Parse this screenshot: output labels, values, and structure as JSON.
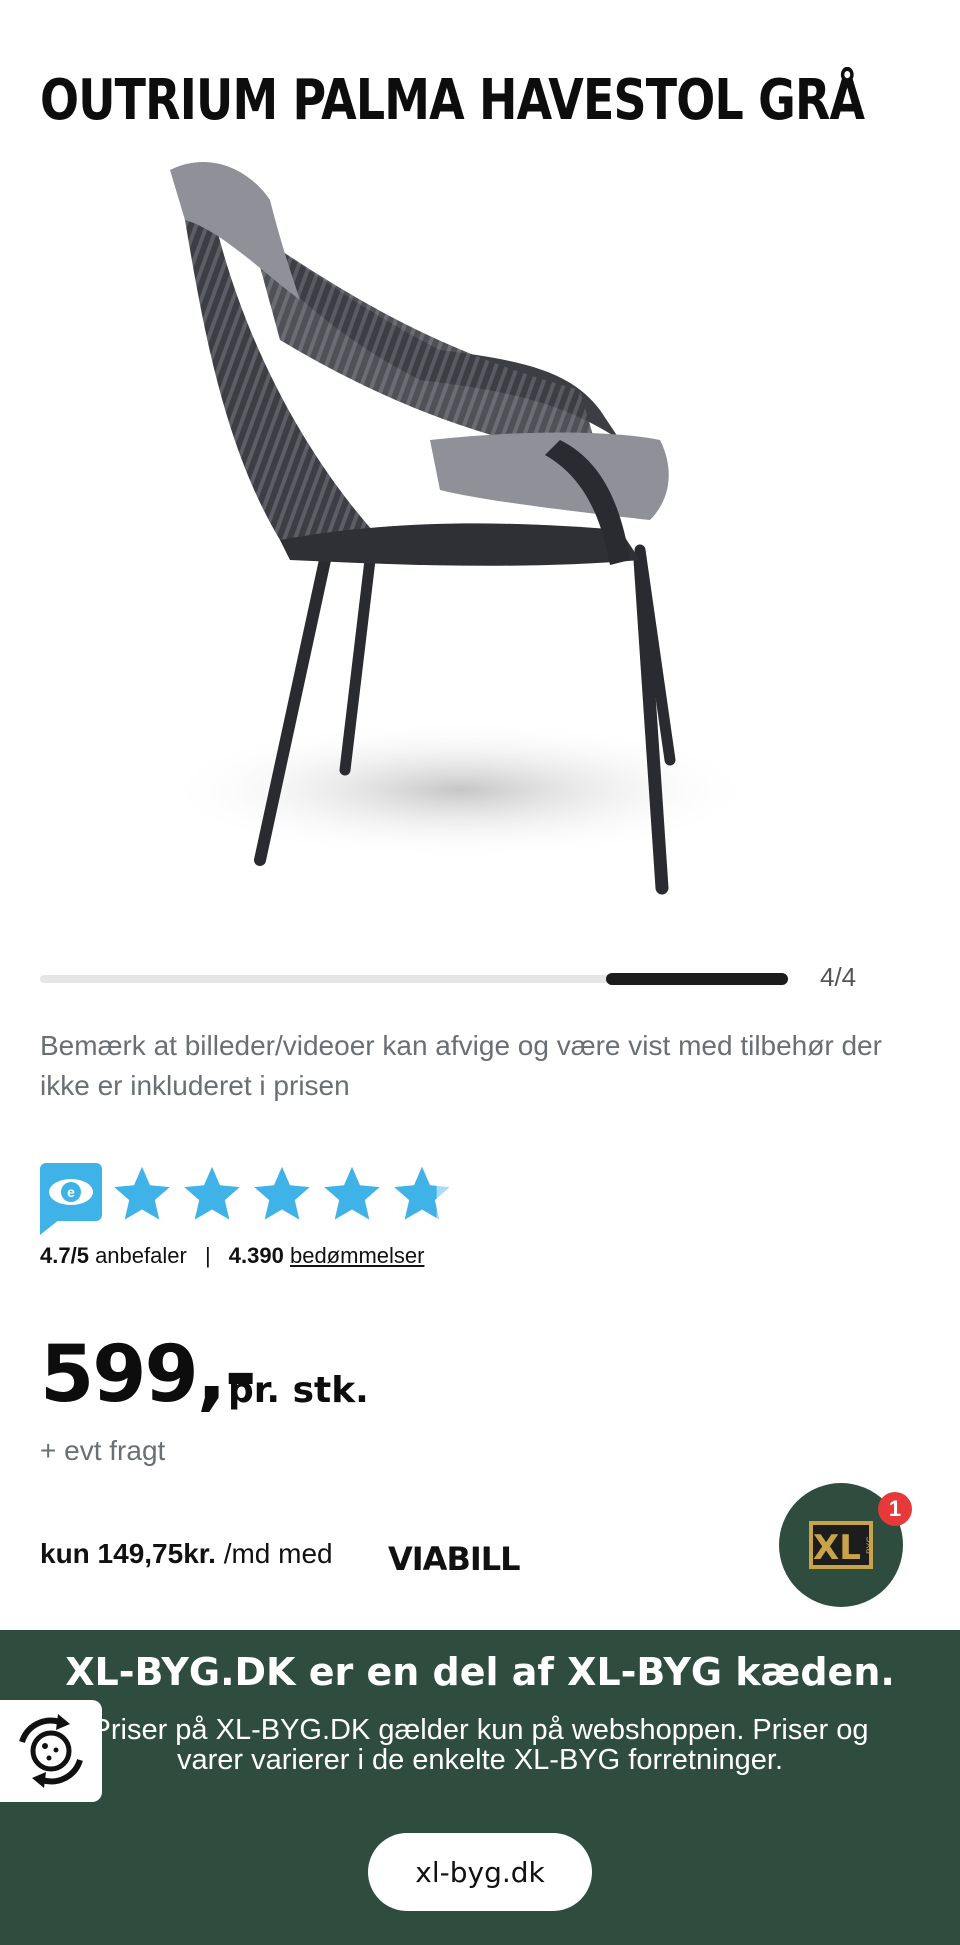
{
  "product": {
    "title": "OUTRIUM PALMA HAVESTOL GRÅ"
  },
  "gallery": {
    "counter": "4/4",
    "position": 4,
    "total": 4
  },
  "disclaimer": "Bemærk at billeder/videoer kan afvige og være vist med tilbehør der ikke er inkluderet i prisen",
  "rating": {
    "score": "4.7/5",
    "recommend_label": "anbefaler",
    "separator": "|",
    "count": "4.390",
    "reviews_link": "bedømmelser",
    "stars_value": 4.7,
    "stars_max": 5
  },
  "price": {
    "amount": "599,-",
    "unit": "pr. stk.",
    "freight": "+ evt fragt"
  },
  "financing": {
    "amount": "kun 149,75kr.",
    "suffix": "/md med",
    "brand": "VIABILL"
  },
  "fab": {
    "logo": "XL",
    "sublogo": "BYG",
    "badge": "1"
  },
  "banner": {
    "title": "XL-BYG.DK er en del af XL-BYG kæden.",
    "text": "Priser på XL-BYG.DK gælder kun på webshoppen. Priser og varer varierer i de enkelte XL-BYG forretninger.",
    "button": "xl-byg.dk"
  },
  "colors": {
    "brand_green": "#2e4d3f",
    "star_blue": "#3fb2e8",
    "badge_red": "#e6393a",
    "logo_gold": "#c9a34a"
  },
  "icons": {
    "rating_badge": "eye-review-icon",
    "star": "star-icon",
    "cookie": "cookie-settings-icon"
  }
}
